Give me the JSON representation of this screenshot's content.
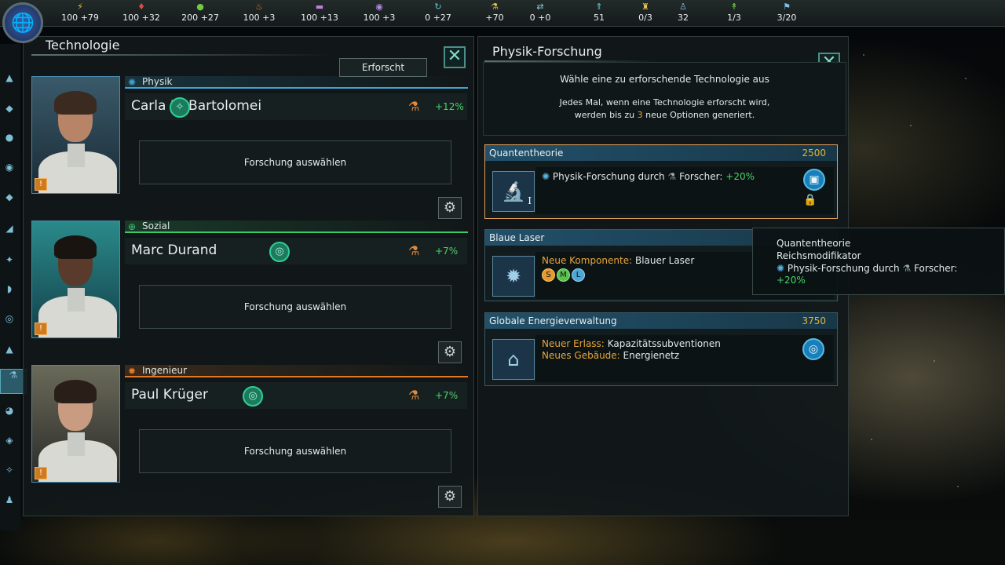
{
  "topbar": {
    "resources": [
      {
        "icon": "energy-icon",
        "value": "100 +79",
        "color": "#e7c14a"
      },
      {
        "icon": "minerals-icon",
        "value": "100 +32",
        "color": "#e04848"
      },
      {
        "icon": "food-icon",
        "value": "200 +27",
        "color": "#6dcc43"
      },
      {
        "icon": "consumer-goods-icon",
        "value": "100 +3",
        "color": "#d9813f"
      },
      {
        "icon": "alloys-icon",
        "value": "100 +13",
        "color": "#c17ee0"
      },
      {
        "icon": "influence-icon",
        "value": "100 +3",
        "color": "#b08ae0"
      },
      {
        "icon": "unity-icon",
        "value": "0 +27",
        "color": "#56c8d6"
      },
      {
        "icon": "research-icon",
        "value": "+70",
        "color": "#e7c14a"
      },
      {
        "icon": "trade-icon",
        "value": "0 +0",
        "color": "#8fd1d8"
      },
      {
        "icon": "naval-capacity-icon",
        "value": "51",
        "color": "#6fd0e0"
      },
      {
        "icon": "starbase-icon",
        "value": "0/3",
        "color": "#e7c14a"
      },
      {
        "icon": "population-icon",
        "value": "32",
        "color": "#7fbfe6"
      },
      {
        "icon": "envoy-icon",
        "value": "1/3",
        "color": "#6dcc43"
      },
      {
        "icon": "systems-icon",
        "value": "3/20",
        "color": "#7fbfe6"
      }
    ]
  },
  "left_panel": {
    "title": "Technologie",
    "researched_button": "Erforscht",
    "scientists": [
      {
        "category": "Physik",
        "category_color": "#3aa6d6",
        "name": "Carla Di Bartolomei",
        "bonus": "+12%",
        "choose": "Forschung auswählen",
        "trait_icon": "lightbulb-icon"
      },
      {
        "category": "Sozial",
        "category_color": "#3ac96a",
        "name": "Marc Durand",
        "bonus": "+7%",
        "choose": "Forschung auswählen",
        "trait_icon": "brain-icon"
      },
      {
        "category": "Ingenieur",
        "category_color": "#e07a2a",
        "name": "Paul Krüger",
        "bonus": "+7%",
        "choose": "Forschung auswählen",
        "trait_icon": "brain-icon"
      }
    ]
  },
  "right_panel": {
    "title": "Physik-Forschung",
    "prompt": "Wähle eine zu erforschende Technologie aus",
    "info_line1": "Jedes Mal, wenn eine Technologie erforscht wird,",
    "info_line2_pre": "werden bis zu ",
    "info_line2_num": "3",
    "info_line2_post": " neue Optionen generiert.",
    "techs": [
      {
        "name": "Quantentheorie",
        "cost": "2500",
        "line1_text": "Physik-Forschung durch",
        "line1_label": "Forscher:",
        "line1_value": "+20%",
        "tier": "I"
      },
      {
        "name": "Blaue Laser",
        "cost": "",
        "line1_label": "Neue Komponente:",
        "line1_value": "Blauer Laser",
        "sizes": [
          "S",
          "M",
          "L"
        ]
      },
      {
        "name": "Globale Energieverwaltung",
        "cost": "3750",
        "line1_label": "Neuer Erlass:",
        "line1_value": "Kapazitätssubventionen",
        "line2_label": "Neues Gebäude:",
        "line2_value": "Energienetz"
      }
    ]
  },
  "tooltip": {
    "title": "Quantentheorie",
    "subtitle": "Reichsmodifikator",
    "line_text": "Physik-Forschung durch",
    "line_label": "Forscher:",
    "line_value": "+20%"
  }
}
